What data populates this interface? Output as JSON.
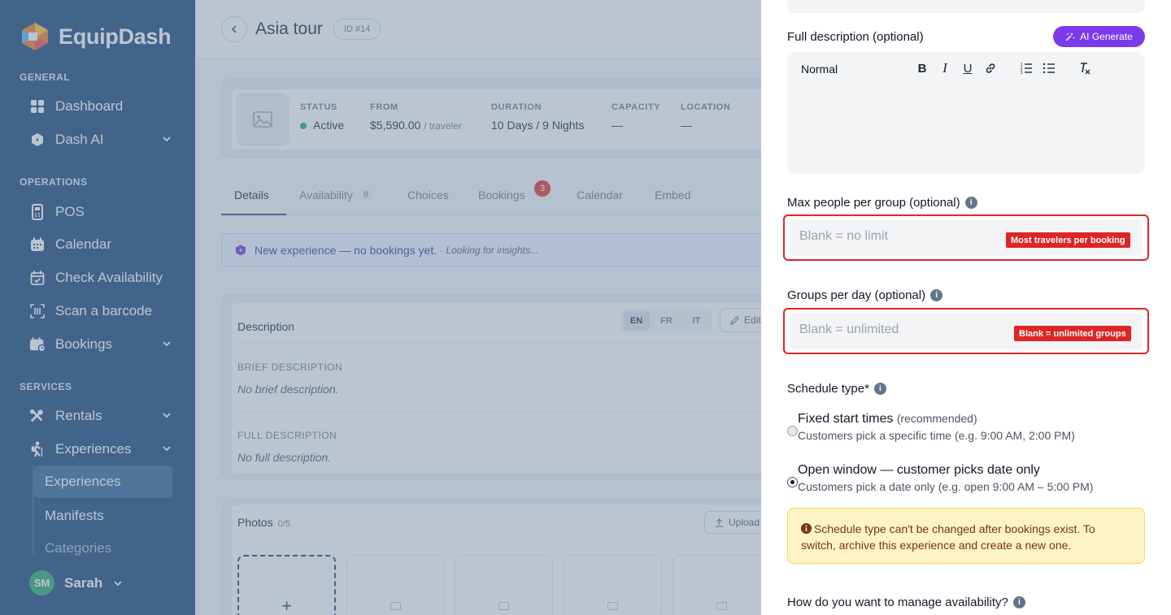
{
  "app": {
    "name": "EquipDash"
  },
  "sidebar": {
    "sections": {
      "general": "GENERAL",
      "operations": "OPERATIONS",
      "services": "SERVICES"
    },
    "items": {
      "dashboard": "Dashboard",
      "dash_ai": "Dash AI",
      "pos": "POS",
      "calendar": "Calendar",
      "check_availability": "Check Availability",
      "scan_barcode": "Scan a barcode",
      "bookings": "Bookings",
      "rentals": "Rentals",
      "experiences": "Experiences"
    },
    "subitems": {
      "experiences": "Experiences",
      "manifests": "Manifests",
      "categories": "Categories"
    },
    "user": {
      "initials": "SM",
      "name": "Sarah"
    }
  },
  "page": {
    "title": "Asia tour",
    "id_badge": "ID #14",
    "summary": {
      "status_label": "STATUS",
      "status_value": "Active",
      "from_label": "FROM",
      "from_value": "$5,590.00",
      "from_unit": "/ traveler",
      "duration_label": "DURATION",
      "duration_value": "10 Days / 9 Nights",
      "capacity_label": "CAPACITY",
      "capacity_value": "—",
      "location_label": "LOCATION",
      "location_value": "—"
    },
    "tabs": {
      "details": "Details",
      "availability": "Availability",
      "availability_count": "8",
      "choices": "Choices",
      "bookings": "Bookings",
      "bookings_badge": "3",
      "calendar": "Calendar",
      "embed": "Embed"
    },
    "banner": {
      "text": "New experience — no bookings yet.",
      "sub": "· Looking for insights..."
    },
    "description": {
      "title": "Description",
      "langs": [
        "EN",
        "FR",
        "IT"
      ],
      "edit": "Edit",
      "brief_label": "BRIEF DESCRIPTION",
      "brief_value": "No brief description.",
      "full_label": "FULL DESCRIPTION",
      "full_value": "No full description."
    },
    "photos": {
      "title": "Photos",
      "count": "0/5",
      "upload": "Upload",
      "add": "+"
    }
  },
  "drawer": {
    "full_description_label": "Full description (optional)",
    "ai_generate": "AI Generate",
    "editor": {
      "format": "Normal"
    },
    "max_people": {
      "label": "Max people per group (optional)",
      "placeholder": "Blank = no limit",
      "tag": "Most travelers per booking"
    },
    "groups_per_day": {
      "label": "Groups per day (optional)",
      "placeholder": "Blank = unlimited",
      "tag": "Blank = unlimited groups"
    },
    "schedule": {
      "label": "Schedule type*",
      "opt1_title": "Fixed start times",
      "opt1_tag": "(recommended)",
      "opt1_sub": "Customers pick a specific time (e.g. 9:00 AM, 2:00 PM)",
      "opt2_title": "Open window — customer picks date only",
      "opt2_sub": "Customers pick a date only (e.g. open 9:00 AM – 5:00 PM)",
      "selected": "open-window"
    },
    "warning": "Schedule type can't be changed after bookings exist. To switch, archive this experience and create a new one.",
    "availability_label": "How do you want to manage availability?"
  },
  "colors": {
    "sidebar": "#0f3d6e",
    "accent_purple": "#7c3aed",
    "error_red": "#dc2626",
    "warning_bg": "#fef3c7"
  }
}
